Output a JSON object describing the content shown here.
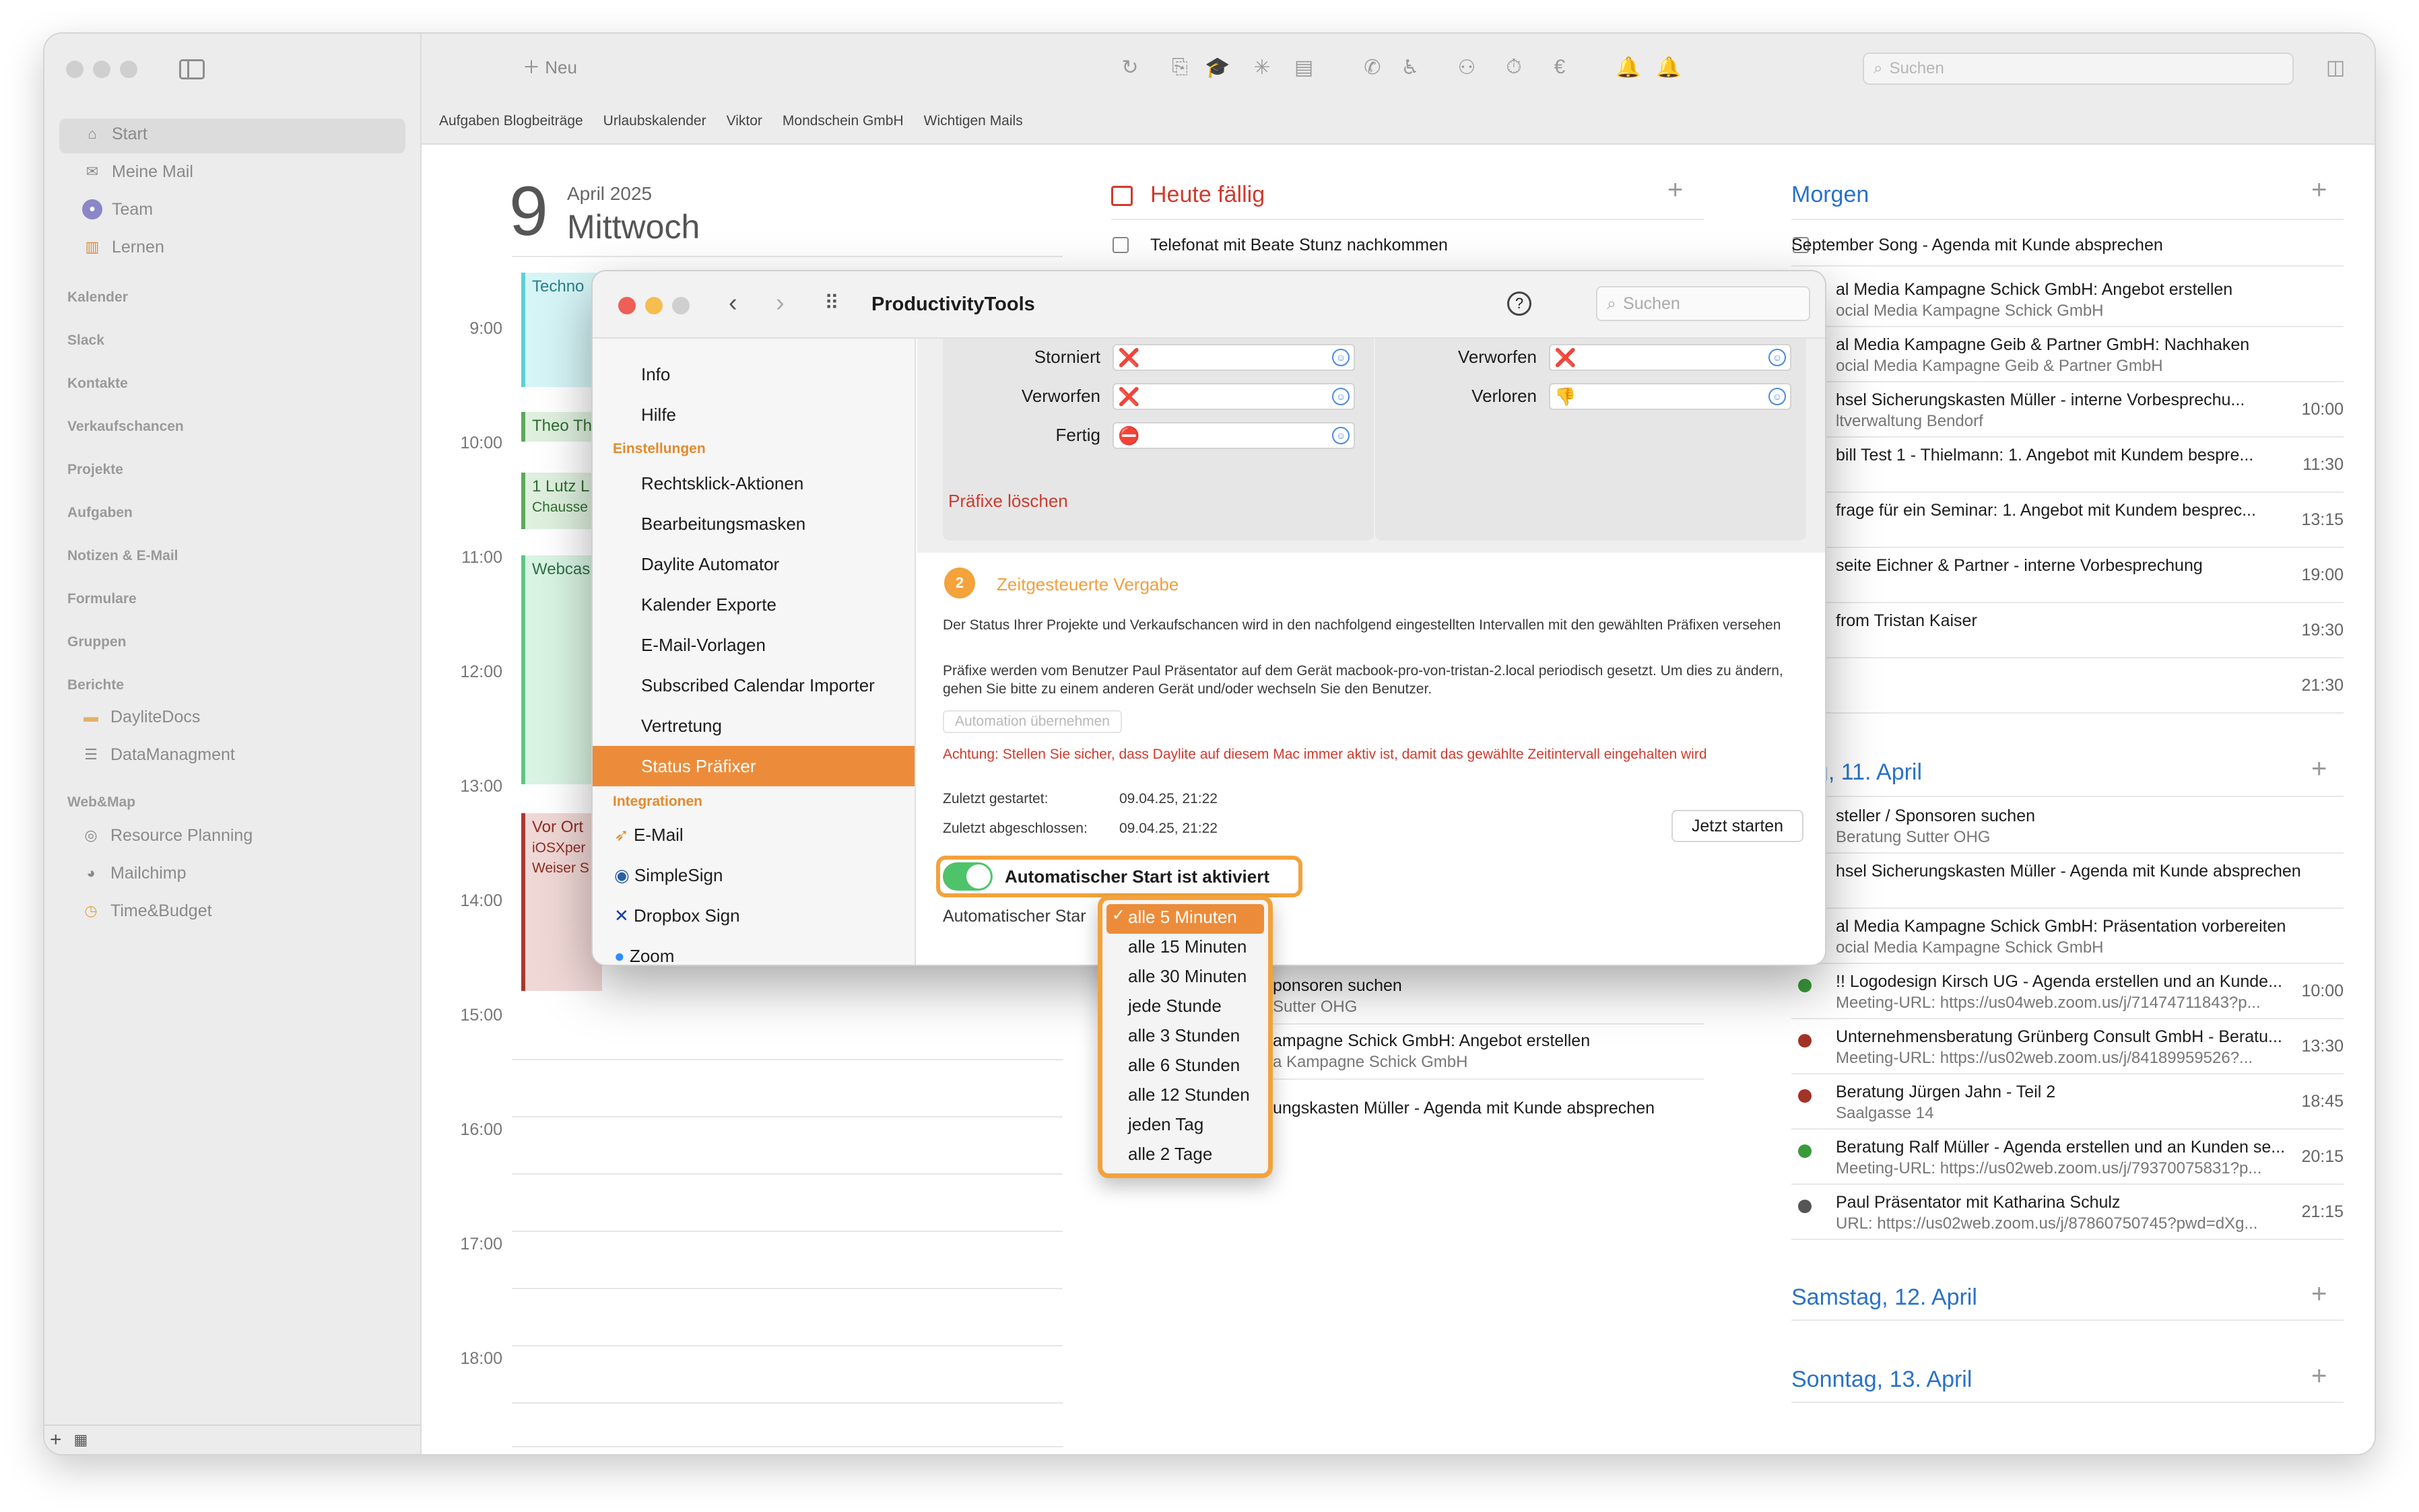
{
  "sidebar": {
    "items": [
      {
        "label": "Start",
        "icon": "house-icon"
      },
      {
        "label": "Meine Mail",
        "icon": "envelope-icon"
      },
      {
        "label": "Team",
        "icon": "team-icon"
      },
      {
        "label": "Lernen",
        "icon": "books-icon"
      }
    ],
    "sections": [
      "Kalender",
      "Slack",
      "Kontakte",
      "Verkaufschancen",
      "Projekte",
      "Aufgaben",
      "Notizen & E-Mail",
      "Formulare",
      "Gruppen",
      "Berichte"
    ],
    "berichte_items": [
      {
        "label": "DayliteDocs",
        "icon": "folder-icon"
      },
      {
        "label": "DataManagment",
        "icon": "database-icon"
      }
    ],
    "webmap_title": "Web&Map",
    "webmap_items": [
      {
        "label": "Resource Planning",
        "icon": "globe-icon"
      },
      {
        "label": "Mailchimp",
        "icon": "mailchimp-icon"
      },
      {
        "label": "Time&Budget",
        "icon": "clock-icon"
      }
    ],
    "bottom_add": "+"
  },
  "toolbar": {
    "new_label": "Neu",
    "search_placeholder": "Suchen",
    "favorites": [
      "Aufgaben Blogbeiträge",
      "Urlaubskalender",
      "Viktor",
      "Mondschein GmbH",
      "Wichtigen Mails"
    ]
  },
  "day": {
    "number": "9",
    "month": "April 2025",
    "weekday": "Mittwoch",
    "hours": [
      "9:00",
      "10:00",
      "11:00",
      "12:00",
      "13:00",
      "14:00",
      "15:00",
      "16:00",
      "17:00",
      "18:00"
    ],
    "events": [
      {
        "title": "Techno",
        "color": "#6fd6df"
      },
      {
        "title": "Theo Th",
        "color": "#6bb56b"
      },
      {
        "title": "1 Lutz L",
        "sub": "Chausse",
        "color": "#6bb56b"
      },
      {
        "title": "Webcas",
        "color": "#6bc98a"
      },
      {
        "title": "Vor Ort",
        "sub": "iOSXper",
        "sub2": "Weiser S",
        "color": "#b0403c"
      }
    ]
  },
  "heute": {
    "title": "Heute fällig",
    "task": "Telefonat mit Beate Stunz nachkommen",
    "rows": [
      {
        "title": "ponsoren suchen",
        "sub": "Sutter OHG"
      },
      {
        "title": "ampagne Schick GmbH: Angebot erstellen",
        "sub": "a Kampagne Schick GmbH"
      },
      {
        "title": "ungskasten Müller - Agenda mit Kunde absprechen"
      }
    ]
  },
  "morgen": {
    "title": "Morgen",
    "task": "September Song - Agenda mit Kunde absprechen",
    "rows": [
      {
        "title": "al Media Kampagne Schick GmbH: Angebot erstellen",
        "sub": "ocial Media Kampagne Schick GmbH",
        "time": ""
      },
      {
        "title": "al Media Kampagne Geib & Partner GmbH: Nachhaken",
        "sub": "ocial Media Kampagne Geib & Partner GmbH",
        "time": ""
      },
      {
        "title": "hsel Sicherungskasten Müller - interne Vorbesprechu...",
        "sub": "ltverwaltung Bendorf",
        "time": "10:00"
      },
      {
        "title": "bill Test 1 - Thielmann: 1. Angebot mit Kundem bespre...",
        "sub": "",
        "time": "11:30"
      },
      {
        "title": "frage für ein Seminar: 1. Angebot mit Kundem besprec...",
        "sub": "",
        "time": "13:15"
      },
      {
        "title": "seite Eichner & Partner - interne Vorbesprechung",
        "sub": "",
        "time": "19:00"
      },
      {
        "title": "from Tristan Kaiser",
        "sub": "",
        "time": "19:30"
      },
      {
        "title": "",
        "sub": "",
        "time": "21:30"
      }
    ]
  },
  "freitag": {
    "title": "itag, 11. April",
    "rows": [
      {
        "title": "steller / Sponsoren suchen",
        "sub": "Beratung Sutter OHG",
        "time": "",
        "dot": ""
      },
      {
        "title": "hsel Sicherungskasten Müller - Agenda mit Kunde absprechen",
        "sub": "",
        "time": "",
        "dot": ""
      },
      {
        "title": "al Media Kampagne Schick GmbH: Präsentation vorbereiten",
        "sub": "ocial Media Kampagne Schick GmbH",
        "time": "",
        "dot": ""
      },
      {
        "title": "!! Logodesign Kirsch UG - Agenda erstellen und an Kunde...",
        "sub": "Meeting-URL: https://us04web.zoom.us/j/71474711843?p...",
        "time": "10:00",
        "dot": "#3a9a3a"
      },
      {
        "title": "Unternehmensberatung Grünberg Consult GmbH - Beratu...",
        "sub": "Meeting-URL: https://us02web.zoom.us/j/84189959526?...",
        "time": "13:30",
        "dot": "#a33327"
      },
      {
        "title": "Beratung Jürgen Jahn - Teil 2",
        "sub": "Saalgasse 14",
        "time": "18:45",
        "dot": "#a33327"
      },
      {
        "title": "Beratung Ralf Müller - Agenda erstellen und an Kunden se...",
        "sub": "Meeting-URL: https://us02web.zoom.us/j/7937007583​1?p...",
        "time": "20:15",
        "dot": "#3a9a3a"
      },
      {
        "title": "Paul Präsentator mit Katharina Schulz",
        "sub": "URL: https://us02web.zoom.us/j/87860750745?pwd=dXg...",
        "time": "21:15",
        "dot": "#555555"
      }
    ]
  },
  "samstag": {
    "title": "Samstag, 12. April"
  },
  "sonntag": {
    "title": "Sonntag, 13. April"
  },
  "dialog": {
    "title": "ProductivityTools",
    "search_placeholder": "Suchen",
    "help": "?",
    "sidebar_top": [
      "Info",
      "Hilfe"
    ],
    "einstellungen_title": "Einstellungen",
    "einstellungen": [
      "Rechtsklick-Aktionen",
      "Bearbeitungsmasken",
      "Daylite Automator",
      "Kalender Exporte",
      "E-Mail-Vorlagen",
      "Subscribed Calendar Importer",
      "Vertretung",
      "Status Präfixer"
    ],
    "integrationen_title": "Integrationen",
    "integrationen": [
      {
        "label": "E-Mail",
        "icon": "paper-plane-icon"
      },
      {
        "label": "SimpleSign",
        "icon": "simplesign-icon"
      },
      {
        "label": "Dropbox Sign",
        "icon": "dropbox-sign-icon"
      },
      {
        "label": "Zoom",
        "icon": "zoom-icon"
      }
    ],
    "left_prefixes": [
      {
        "label": "Storniert",
        "emoji": "❌"
      },
      {
        "label": "Verworfen",
        "emoji": "❌"
      },
      {
        "label": "Fertig",
        "emoji": "⛔"
      }
    ],
    "right_prefixes": [
      {
        "label": "Verworfen",
        "emoji": "❌"
      },
      {
        "label": "Verloren",
        "emoji": "👎"
      }
    ],
    "clear_prefixes": "Präfixe löschen",
    "step_number": "2",
    "step_title": "Zeitgesteuerte Vergabe",
    "desc1": "Der Status Ihrer Projekte und Verkaufschancen wird in den nachfolgend eingestellten Intervallen mit den gewählten Präfixen versehen",
    "desc2": "Präfixe werden vom Benutzer Paul Präsentator auf dem Gerät macbook-pro-von-tristan-2.local periodisch gesetzt. Um dies zu ändern, gehen Sie bitte zu einem anderen Gerät und/oder wechseln Sie den Benutzer.",
    "automation_button": "Automation übernehmen",
    "warning": "Achtung: Stellen Sie sicher, dass Daylite auf diesem Mac immer aktiv ist, damit das gewählte Zeitintervall eingehalten wird",
    "started_label": "Zuletzt gestartet:",
    "started_value": "09.04.25, 21:22",
    "finished_label": "Zuletzt abgeschlossen:",
    "finished_value": "09.04.25, 21:22",
    "start_now": "Jetzt starten",
    "toggle_label": "Automatischer Start ist aktiviert",
    "toggle_on": true,
    "interval_label": "Automatischer Star",
    "interval_options": [
      "alle 5 Minuten",
      "alle 15 Minuten",
      "alle 30 Minuten",
      "jede Stunde",
      "alle 3 Stunden",
      "alle 6 Stunden",
      "alle 12 Stunden",
      "jeden Tag",
      "alle 2 Tage"
    ],
    "interval_selected": "alle 5 Minuten"
  },
  "colors": {
    "accent": "#ec8c3a",
    "link": "#2a72c9",
    "danger": "#d03a2e",
    "highlight": "#f3a23c"
  }
}
